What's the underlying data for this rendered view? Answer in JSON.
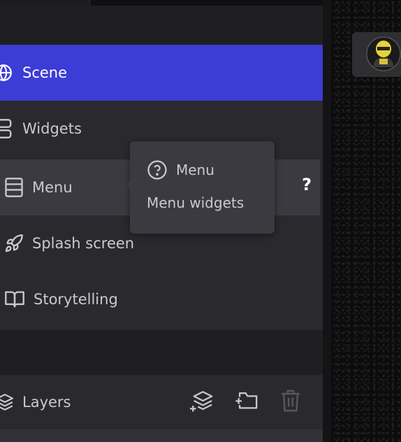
{
  "sidebar": {
    "items": [
      {
        "label": "Scene",
        "icon": "globe-icon"
      },
      {
        "label": "Widgets",
        "icon": "widgets-icon"
      },
      {
        "label": "Menu",
        "icon": "menu-list-icon"
      },
      {
        "label": "Splash screen",
        "icon": "rocket-icon"
      },
      {
        "label": "Storytelling",
        "icon": "book-icon"
      }
    ],
    "active_index": 0,
    "hovered_help": "?"
  },
  "tooltip": {
    "title": "Menu",
    "subtitle": "Menu widgets",
    "icon": "question-circle-icon"
  },
  "layers": {
    "label": "Layers",
    "actions": [
      "add-layer-icon",
      "add-folder-icon",
      "trash-icon"
    ]
  },
  "colors": {
    "accent": "#3c3cd6",
    "panel": "#2a2a2e",
    "text": "#c9c9cf"
  }
}
